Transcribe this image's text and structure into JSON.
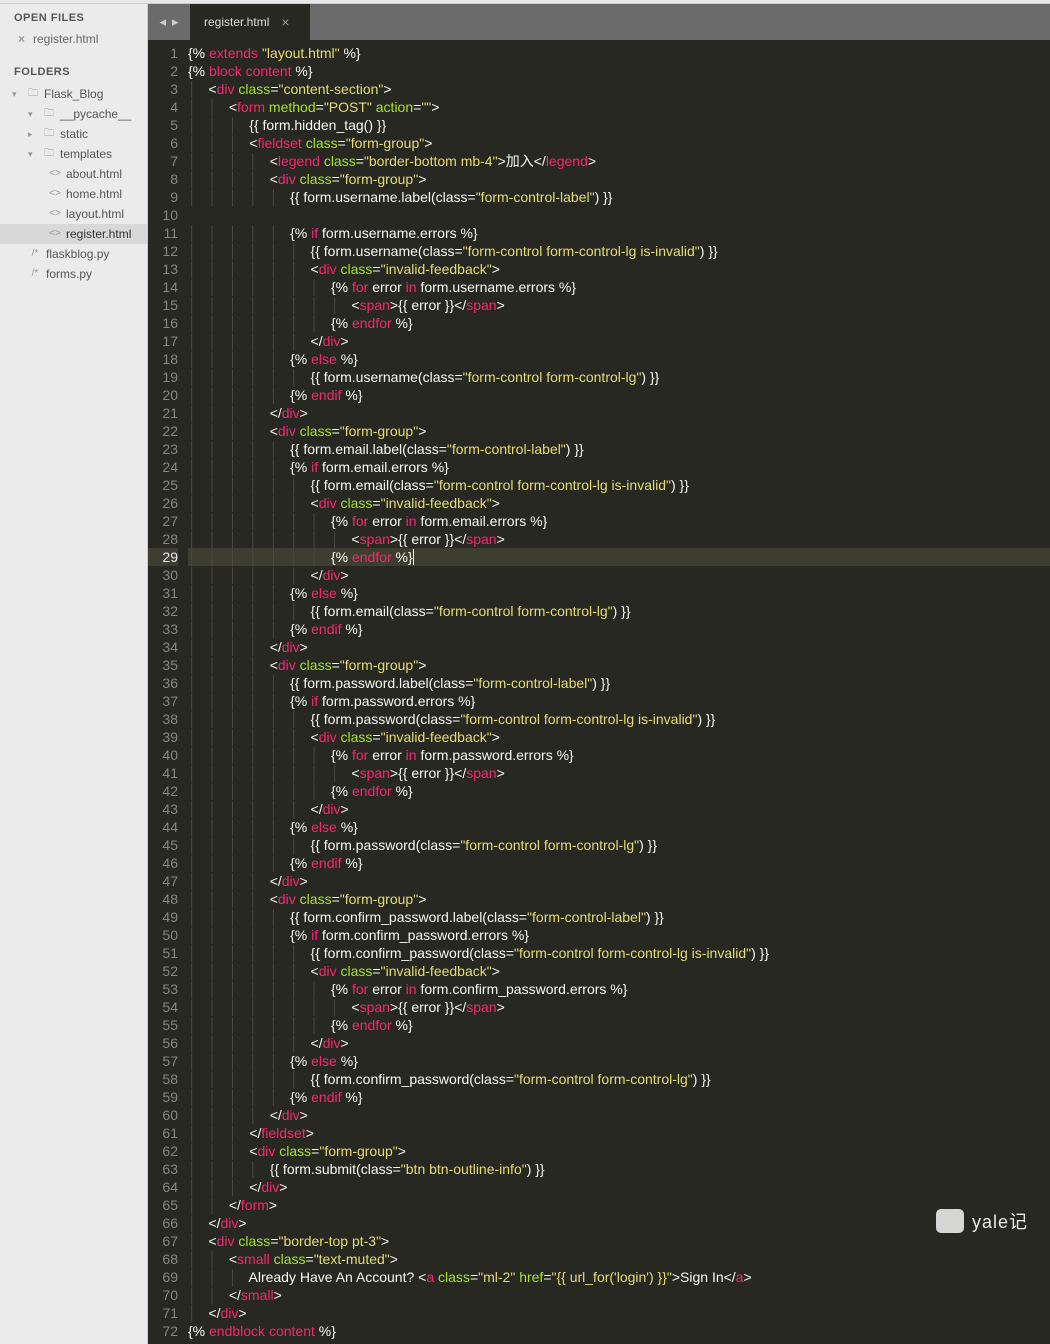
{
  "sidebar": {
    "openFilesHeading": "OPEN FILES",
    "openFiles": [
      {
        "name": "register.html"
      }
    ],
    "foldersHeading": "FOLDERS",
    "tree": {
      "root": "Flask_Blog",
      "folders": [
        "__pycache__",
        "static",
        "templates"
      ],
      "template_files": [
        "about.html",
        "home.html",
        "layout.html",
        "register.html"
      ],
      "root_files": [
        "flaskblog.py",
        "forms.py"
      ]
    }
  },
  "tab": {
    "label": "register.html"
  },
  "code": [
    {
      "n": 1,
      "html": "{% <span class='tagname'>extends</span> <span class='str'>\"layout.html\"</span> %}"
    },
    {
      "n": 2,
      "html": "{% <span class='tagname'>block content</span> %}"
    },
    {
      "n": 3,
      "html": "    &lt;<span class='tagname'>div</span> <span class='attr'>class</span>=<span class='str'>\"content-section\"</span>&gt;"
    },
    {
      "n": 4,
      "html": "        &lt;<span class='tagname'>form</span> <span class='attr'>method</span>=<span class='str'>\"POST\"</span> <span class='attr'>action</span>=<span class='str'>\"\"</span>&gt;"
    },
    {
      "n": 5,
      "html": "            {{ form.hidden_tag() }}"
    },
    {
      "n": 6,
      "html": "            &lt;<span class='tagname'>fieldset</span> <span class='attr'>class</span>=<span class='str'>\"form-group\"</span>&gt;"
    },
    {
      "n": 7,
      "html": "                &lt;<span class='tagname'>legend</span> <span class='attr'>class</span>=<span class='str'>\"border-bottom mb-4\"</span>&gt;加入&lt;/<span class='tagname'>legend</span>&gt;"
    },
    {
      "n": 8,
      "html": "                &lt;<span class='tagname'>div</span> <span class='attr'>class</span>=<span class='str'>\"form-group\"</span>&gt;"
    },
    {
      "n": 9,
      "html": "                    {{ form.username.label(class=<span class='str'>\"form-control-label\"</span>) }}"
    },
    {
      "n": 10,
      "html": ""
    },
    {
      "n": 11,
      "html": "                    {% <span class='tagname'>if</span> form.username.errors %}"
    },
    {
      "n": 12,
      "html": "                        {{ form.username(class=<span class='str'>\"form-control form-control-lg is-invalid\"</span>) }}"
    },
    {
      "n": 13,
      "html": "                        &lt;<span class='tagname'>div</span> <span class='attr'>class</span>=<span class='str'>\"invalid-feedback\"</span>&gt;"
    },
    {
      "n": 14,
      "html": "                            {% <span class='tagname'>for</span> error <span class='tagname'>in</span> form.username.errors %}"
    },
    {
      "n": 15,
      "html": "                                &lt;<span class='tagname'>span</span>&gt;{{ error }}&lt;/<span class='tagname'>span</span>&gt;"
    },
    {
      "n": 16,
      "html": "                            {% <span class='tagname'>endfor</span> %}"
    },
    {
      "n": 17,
      "html": "                        &lt;/<span class='tagname'>div</span>&gt;"
    },
    {
      "n": 18,
      "html": "                    {% <span class='tagname'>else</span> %}"
    },
    {
      "n": 19,
      "html": "                        {{ form.username(class=<span class='str'>\"form-control form-control-lg\"</span>) }}"
    },
    {
      "n": 20,
      "html": "                    {% <span class='tagname'>endif</span> %}"
    },
    {
      "n": 21,
      "html": "                &lt;/<span class='tagname'>div</span>&gt;"
    },
    {
      "n": 22,
      "html": "                &lt;<span class='tagname'>div</span> <span class='attr'>class</span>=<span class='str'>\"form-group\"</span>&gt;"
    },
    {
      "n": 23,
      "html": "                    {{ form.email.label(class=<span class='str'>\"form-control-label\"</span>) }}"
    },
    {
      "n": 24,
      "html": "                    {% <span class='tagname'>if</span> form.email.errors %}"
    },
    {
      "n": 25,
      "html": "                        {{ form.email(class=<span class='str'>\"form-control form-control-lg is-invalid\"</span>) }}"
    },
    {
      "n": 26,
      "html": "                        &lt;<span class='tagname'>div</span> <span class='attr'>class</span>=<span class='str'>\"invalid-feedback\"</span>&gt;"
    },
    {
      "n": 27,
      "html": "                            {% <span class='tagname'>for</span> error <span class='tagname'>in</span> form.email.errors %}"
    },
    {
      "n": 28,
      "html": "                                &lt;<span class='tagname'>span</span>&gt;{{ error }}&lt;/<span class='tagname'>span</span>&gt;"
    },
    {
      "n": 29,
      "html": "                            {% <span class='tagname'>endfor</span> %}<span style='border-left:1px solid #f8f8f2;'>&nbsp;</span>",
      "hl": true
    },
    {
      "n": 30,
      "html": "                        &lt;/<span class='tagname'>div</span>&gt;"
    },
    {
      "n": 31,
      "html": "                    {% <span class='tagname'>else</span> %}"
    },
    {
      "n": 32,
      "html": "                        {{ form.email(class=<span class='str'>\"form-control form-control-lg\"</span>) }}"
    },
    {
      "n": 33,
      "html": "                    {% <span class='tagname'>endif</span> %}"
    },
    {
      "n": 34,
      "html": "                &lt;/<span class='tagname'>div</span>&gt;"
    },
    {
      "n": 35,
      "html": "                &lt;<span class='tagname'>div</span> <span class='attr'>class</span>=<span class='str'>\"form-group\"</span>&gt;"
    },
    {
      "n": 36,
      "html": "                    {{ form.password.label(class=<span class='str'>\"form-control-label\"</span>) }}"
    },
    {
      "n": 37,
      "html": "                    {% <span class='tagname'>if</span> form.password.errors %}"
    },
    {
      "n": 38,
      "html": "                        {{ form.password(class=<span class='str'>\"form-control form-control-lg is-invalid\"</span>) }}"
    },
    {
      "n": 39,
      "html": "                        &lt;<span class='tagname'>div</span> <span class='attr'>class</span>=<span class='str'>\"invalid-feedback\"</span>&gt;"
    },
    {
      "n": 40,
      "html": "                            {% <span class='tagname'>for</span> error <span class='tagname'>in</span> form.password.errors %}"
    },
    {
      "n": 41,
      "html": "                                &lt;<span class='tagname'>span</span>&gt;{{ error }}&lt;/<span class='tagname'>span</span>&gt;"
    },
    {
      "n": 42,
      "html": "                            {% <span class='tagname'>endfor</span> %}"
    },
    {
      "n": 43,
      "html": "                        &lt;/<span class='tagname'>div</span>&gt;"
    },
    {
      "n": 44,
      "html": "                    {% <span class='tagname'>else</span> %}"
    },
    {
      "n": 45,
      "html": "                        {{ form.password(class=<span class='str'>\"form-control form-control-lg\"</span>) }}"
    },
    {
      "n": 46,
      "html": "                    {% <span class='tagname'>endif</span> %}"
    },
    {
      "n": 47,
      "html": "                &lt;/<span class='tagname'>div</span>&gt;"
    },
    {
      "n": 48,
      "html": "                &lt;<span class='tagname'>div</span> <span class='attr'>class</span>=<span class='str'>\"form-group\"</span>&gt;"
    },
    {
      "n": 49,
      "html": "                    {{ form.confirm_password.label(class=<span class='str'>\"form-control-label\"</span>) }}"
    },
    {
      "n": 50,
      "html": "                    {% <span class='tagname'>if</span> form.confirm_password.errors %}"
    },
    {
      "n": 51,
      "html": "                        {{ form.confirm_password(class=<span class='str'>\"form-control form-control-lg is-invalid\"</span>) }}"
    },
    {
      "n": 52,
      "html": "                        &lt;<span class='tagname'>div</span> <span class='attr'>class</span>=<span class='str'>\"invalid-feedback\"</span>&gt;"
    },
    {
      "n": 53,
      "html": "                            {% <span class='tagname'>for</span> error <span class='tagname'>in</span> form.confirm_password.errors %}"
    },
    {
      "n": 54,
      "html": "                                &lt;<span class='tagname'>span</span>&gt;{{ error }}&lt;/<span class='tagname'>span</span>&gt;"
    },
    {
      "n": 55,
      "html": "                            {% <span class='tagname'>endfor</span> %}"
    },
    {
      "n": 56,
      "html": "                        &lt;/<span class='tagname'>div</span>&gt;"
    },
    {
      "n": 57,
      "html": "                    {% <span class='tagname'>else</span> %}"
    },
    {
      "n": 58,
      "html": "                        {{ form.confirm_password(class=<span class='str'>\"form-control form-control-lg\"</span>) }}"
    },
    {
      "n": 59,
      "html": "                    {% <span class='tagname'>endif</span> %}"
    },
    {
      "n": 60,
      "html": "                &lt;/<span class='tagname'>div</span>&gt;"
    },
    {
      "n": 61,
      "html": "            &lt;/<span class='tagname'>fieldset</span>&gt;"
    },
    {
      "n": 62,
      "html": "            &lt;<span class='tagname'>div</span> <span class='attr'>class</span>=<span class='str'>\"form-group\"</span>&gt;"
    },
    {
      "n": 63,
      "html": "                {{ form.submit(class=<span class='str'>\"btn btn-outline-info\"</span>) }}"
    },
    {
      "n": 64,
      "html": "            &lt;/<span class='tagname'>div</span>&gt;"
    },
    {
      "n": 65,
      "html": "        &lt;/<span class='tagname'>form</span>&gt;"
    },
    {
      "n": 66,
      "html": "    &lt;/<span class='tagname'>div</span>&gt;"
    },
    {
      "n": 67,
      "html": "    &lt;<span class='tagname'>div</span> <span class='attr'>class</span>=<span class='str'>\"border-top pt-3\"</span>&gt;"
    },
    {
      "n": 68,
      "html": "        &lt;<span class='tagname'>small</span> <span class='attr'>class</span>=<span class='str'>\"text-muted\"</span>&gt;"
    },
    {
      "n": 69,
      "html": "            Already Have An Account? &lt;<span class='tagname'>a</span> <span class='attr'>class</span>=<span class='str'>\"ml-2\"</span> <span class='attr'>href</span>=<span class='str'>\"{{ url_for('login') }}\"</span>&gt;Sign In&lt;/<span class='tagname'>a</span>&gt;"
    },
    {
      "n": 70,
      "html": "        &lt;/<span class='tagname'>small</span>&gt;"
    },
    {
      "n": 71,
      "html": "    &lt;/<span class='tagname'>div</span>&gt;"
    },
    {
      "n": 72,
      "html": "{% <span class='tagname'>endblock content</span> %}"
    }
  ],
  "watermark": "yale记"
}
